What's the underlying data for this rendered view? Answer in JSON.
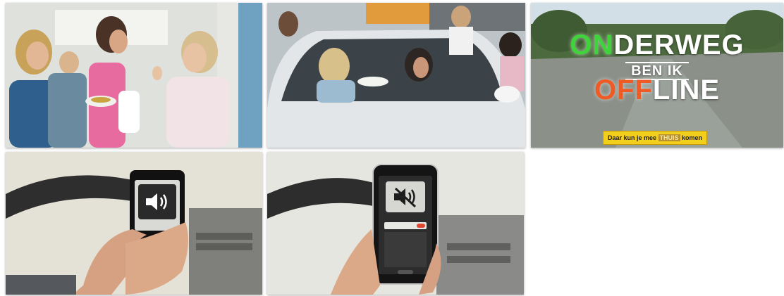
{
  "banner": {
    "title_on": "ON",
    "title_derweg": "DERWEG",
    "title_mid": "BEN IK",
    "title_off": "OFF",
    "title_line": "LINE",
    "slogan_before": "Daar kun je mee ",
    "slogan_highlight": "THUIS",
    "slogan_after": " komen"
  },
  "phones": [
    {
      "icon": "speaker-on-icon"
    },
    {
      "icon": "speaker-muted-icon"
    }
  ],
  "colors": {
    "on": "#3ed43a",
    "off": "#f05a24",
    "slogan_bg": "#f2cf1d"
  }
}
